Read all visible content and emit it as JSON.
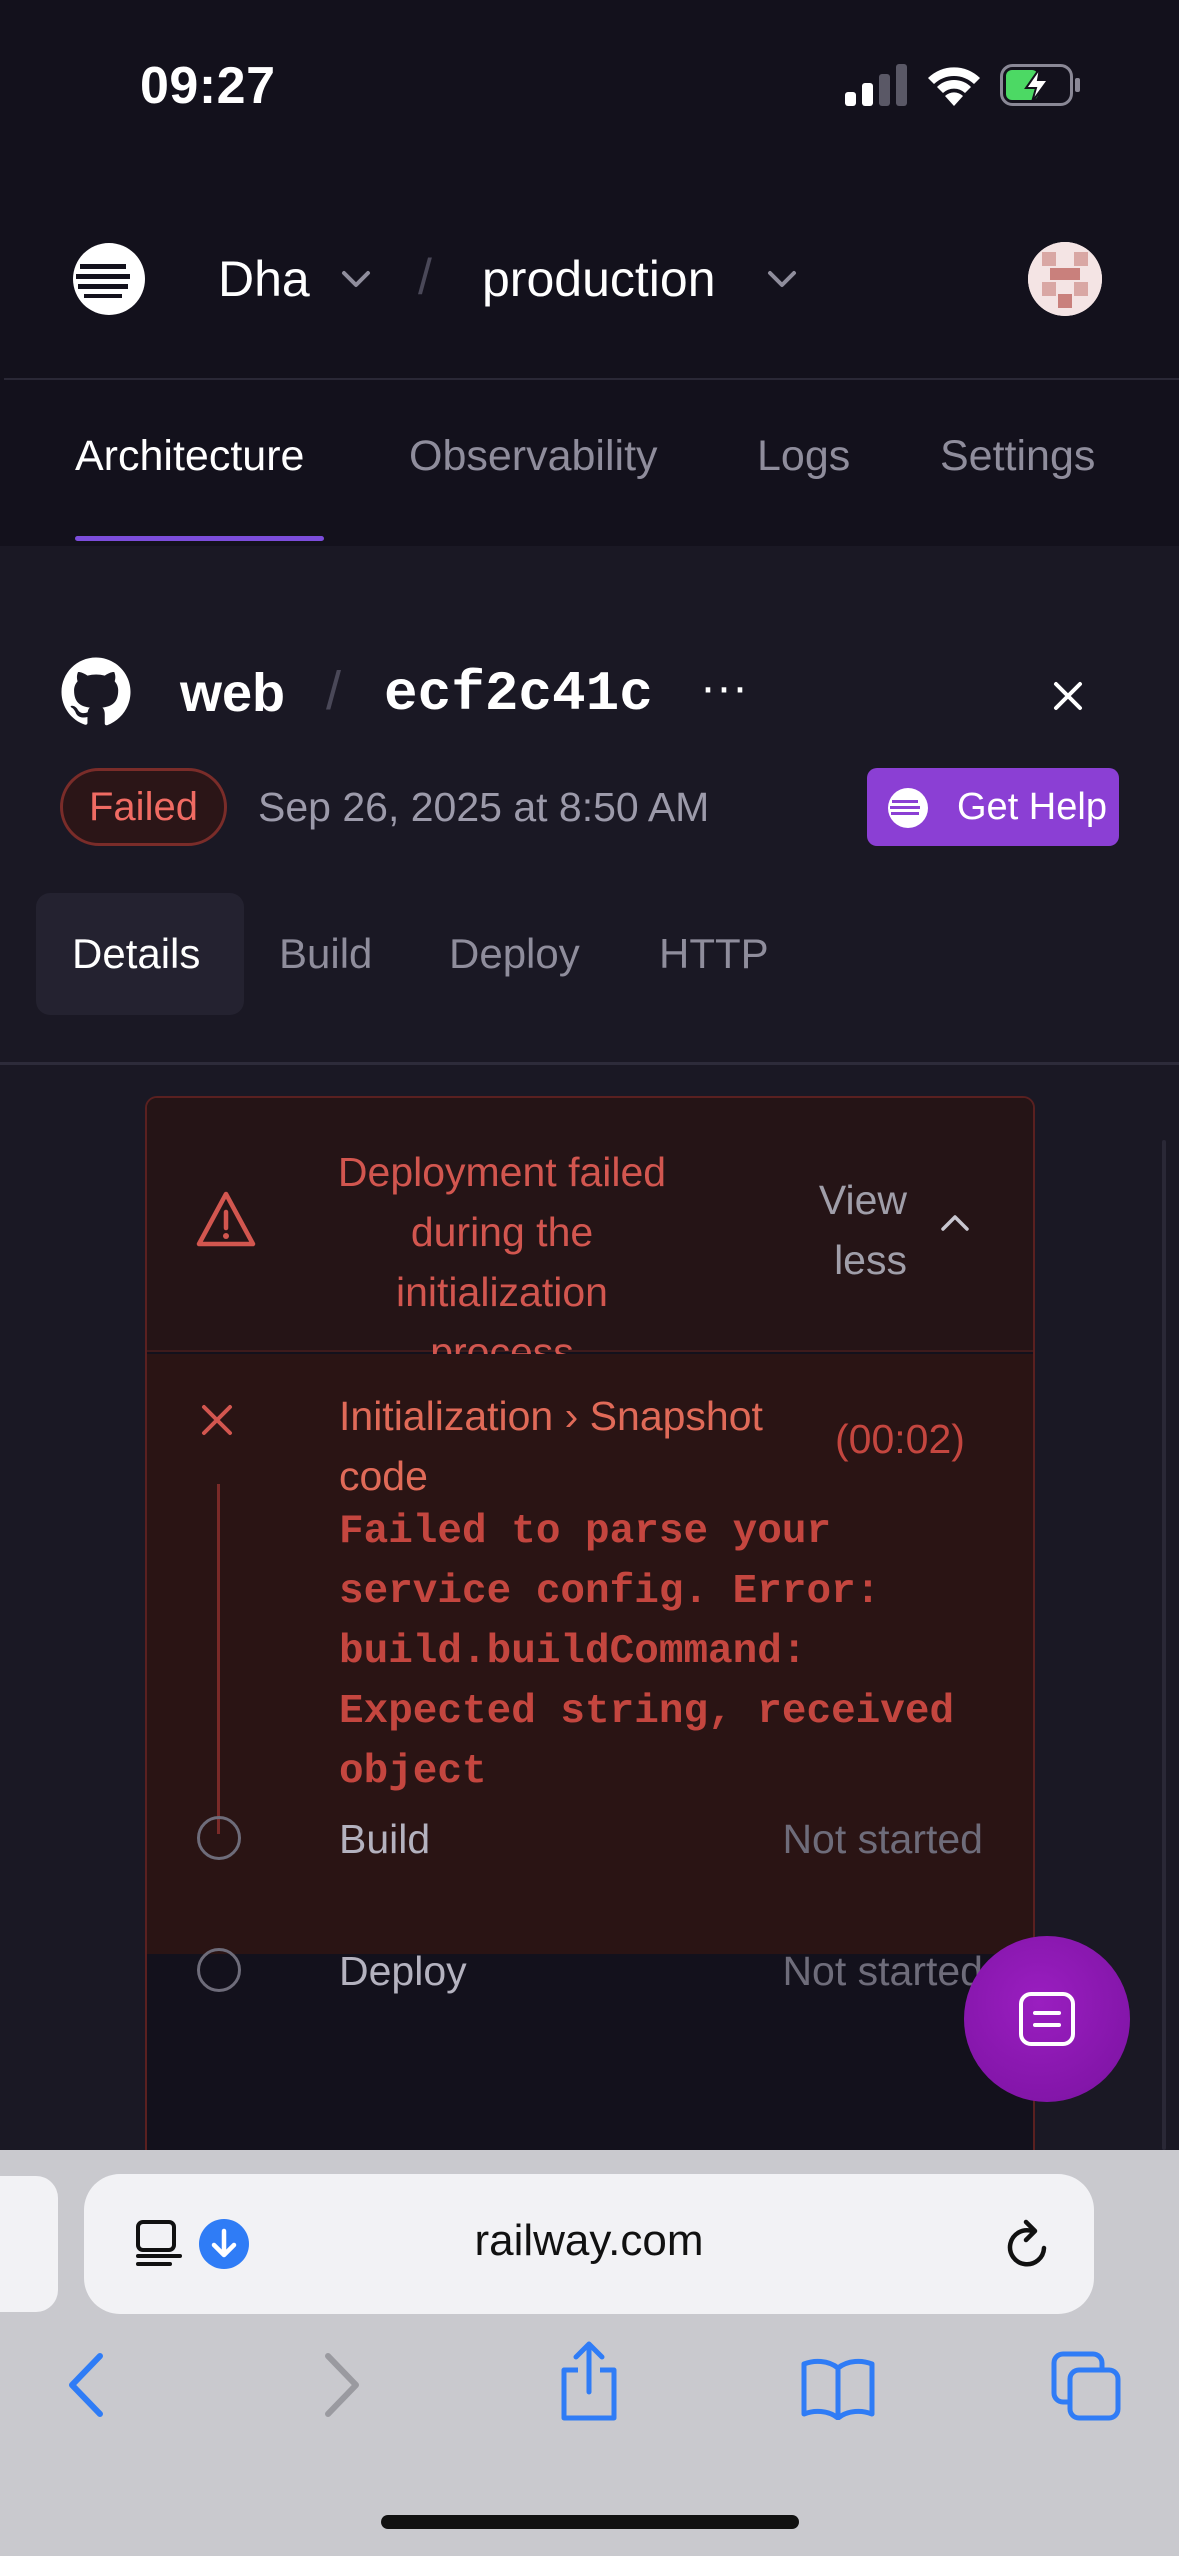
{
  "status_bar": {
    "time": "09:27"
  },
  "header": {
    "project": "Dha",
    "separator": "/",
    "environment": "production"
  },
  "top_tabs": [
    {
      "label": "Architecture",
      "active": true
    },
    {
      "label": "Observability"
    },
    {
      "label": "Logs"
    },
    {
      "label": "Settings"
    }
  ],
  "deployment": {
    "service": "web",
    "separator": "/",
    "commit": "ecf2c41c",
    "more": "···",
    "status": "Failed",
    "date": "Sep 26, 2025 at 8:50 AM",
    "help_label": "Get Help"
  },
  "sub_tabs": [
    {
      "label": "Details",
      "active": true
    },
    {
      "label": "Build"
    },
    {
      "label": "Deploy"
    },
    {
      "label": "HTTP"
    }
  ],
  "error_card": {
    "message": "Deployment failed during the initialization process",
    "toggle_label": "View less",
    "step": {
      "title": "Initialization › Snapshot code",
      "duration": "(00:02)",
      "error": "Failed to parse your service config. Error: build.buildCommand: Expected string, received object"
    },
    "other_steps": [
      {
        "label": "Build",
        "status": "Not started"
      },
      {
        "label": "Deploy",
        "status": "Not started"
      }
    ]
  },
  "browser": {
    "url": "railway.com"
  },
  "colors": {
    "background": "#13111c",
    "accent": "#7c4ddb",
    "error": "#c4463f",
    "help_button": "#8b3fd4"
  }
}
